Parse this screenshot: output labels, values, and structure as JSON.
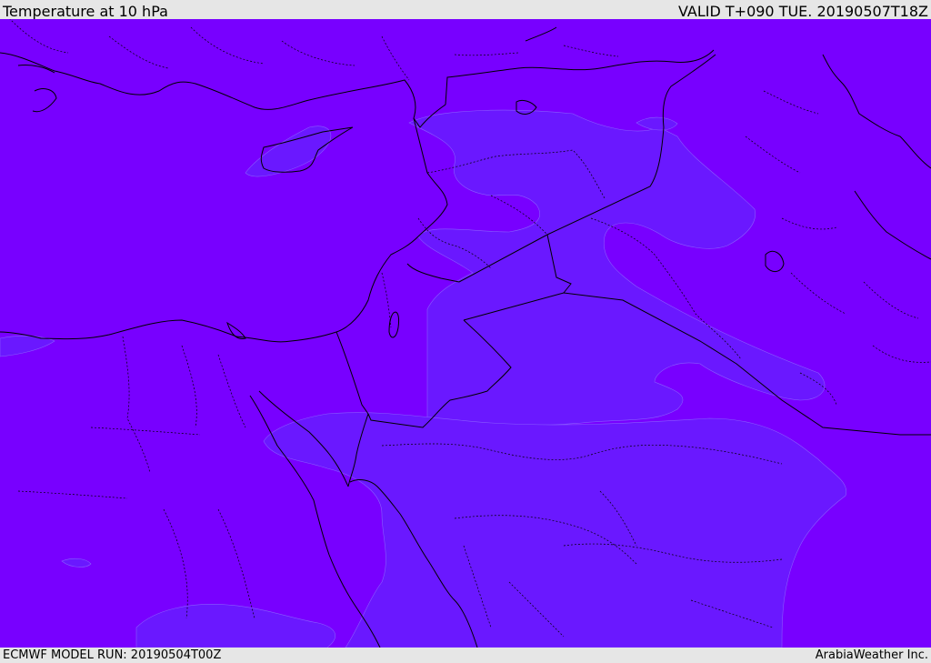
{
  "header": {
    "title": "Temperature at 10 hPa",
    "valid_time": "VALID T+090 TUE. 20190507T18Z"
  },
  "footer": {
    "model_run": "ECMWF MODEL RUN: 20190504T00Z",
    "credit": "ArabiaWeather Inc."
  },
  "map": {
    "fill_colors": {
      "background": "#7800ff",
      "warm_band": "#6a18ff"
    },
    "line_colors": {
      "coastline": "#000000",
      "border": "#000000"
    }
  }
}
